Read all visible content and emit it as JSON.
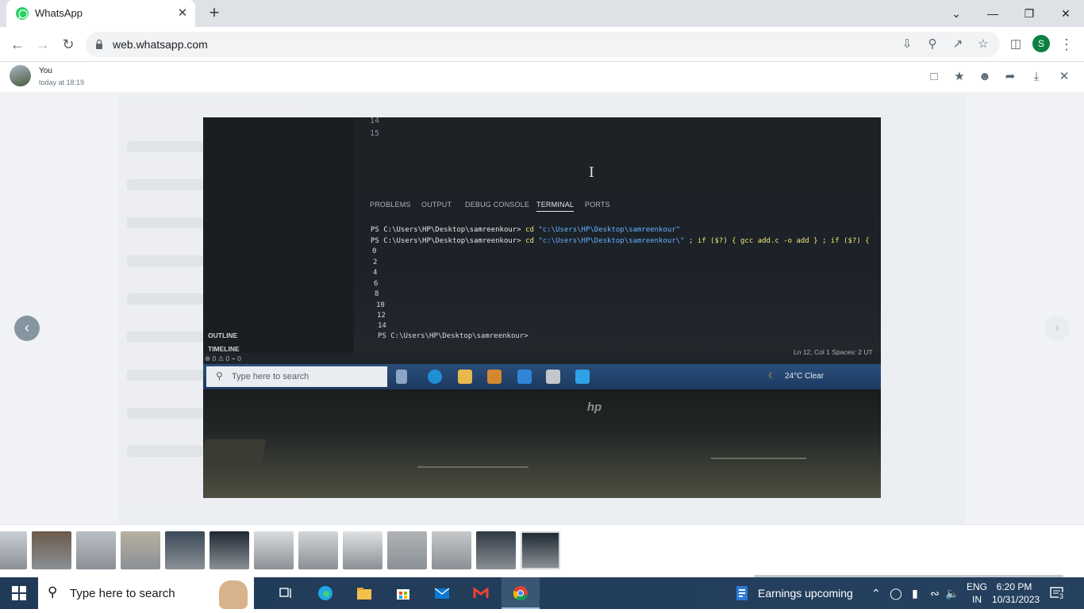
{
  "browser": {
    "tab_title": "WhatsApp",
    "tab_close": "✕",
    "new_tab": "+",
    "url": "web.whatsapp.com",
    "profile_initial": "S",
    "window_controls": [
      "⌄",
      "—",
      "❐",
      "✕"
    ]
  },
  "viewer": {
    "sender": "You",
    "timestamp": "today at 18:19",
    "header_icons": [
      "message-icon",
      "star-icon",
      "emoji-icon",
      "forward-icon",
      "download-icon",
      "close-icon"
    ]
  },
  "photo_content": {
    "line_numbers": [
      "14",
      "15"
    ],
    "panel_tabs": [
      "PROBLEMS",
      "OUTPUT",
      "DEBUG CONSOLE",
      "TERMINAL",
      "PORTS"
    ],
    "active_panel_tab": "TERMINAL",
    "terminal_lines": [
      {
        "prompt": "PS C:\\Users\\HP\\Desktop\\samreenkour>",
        "cmd": "cd",
        "arg": "\"c:\\Users\\HP\\Desktop\\samreenkour\""
      },
      {
        "prompt": "PS C:\\Users\\HP\\Desktop\\samreenkour>",
        "cmd": "cd",
        "arg": "\"c:\\Users\\HP\\Desktop\\samreenkour\\\"",
        "rest": " ; if ($?) { gcc add.c -o add } ; if ($?) {"
      }
    ],
    "output_values": [
      "0",
      "2",
      "4",
      "6",
      "8",
      "10",
      "12",
      "14"
    ],
    "final_prompt": "PS C:\\Users\\HP\\Desktop\\samreenkour>",
    "sidebar_sections": [
      "OUTLINE",
      "TIMELINE"
    ],
    "status_left": "⊗ 0 ⚠ 0   ⌁ 0",
    "status_right": "Ln 12, Col 1   Spaces: 2   UT",
    "inner_search_placeholder": "Type here to search",
    "inner_weather": "24°C  Clear",
    "laptop_brand": "hp"
  },
  "thumbnails": {
    "count": 13,
    "selected_index": 12,
    "colors": [
      "#c9cfd4",
      "#6b5a4a",
      "#b9bfc4",
      "#b8b0a0",
      "#3b4958",
      "#1f2833",
      "#d9dcde",
      "#d3d6d8",
      "#dfe2e4",
      "#b0b3b6",
      "#c6c8ca",
      "#2f3944",
      "#1f2a33"
    ]
  },
  "taskbar": {
    "search_placeholder": "Type here to search",
    "weather_text": "Earnings upcoming",
    "language_line1": "ENG",
    "language_line2": "IN",
    "time": "6:20 PM",
    "date": "10/31/2023",
    "notification_count": "3"
  },
  "colors": {
    "whatsapp_green": "#25d366",
    "chrome_accent": "#0b8043"
  }
}
